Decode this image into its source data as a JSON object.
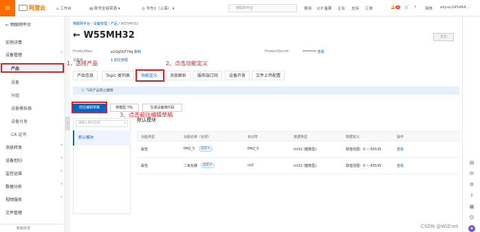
{
  "topbar": {
    "logo": "阿里云",
    "workspace": "工作台",
    "resource_group": "账号全部资源",
    "region": "华东2（上海）",
    "search_placeholder": "物联网平台",
    "links": [
      "费用",
      "ICP 备案",
      "企业",
      "支持",
      "工单"
    ],
    "badge": "49",
    "lang": "简体",
    "user": "aliyun245464..."
  },
  "sidebar": {
    "title": "物联网平台",
    "items": [
      "实例详情",
      "设备管理",
      "产品",
      "设备",
      "分组",
      "设备模拟器",
      "设备分发",
      "CA 证书",
      "消息转发",
      "设备划归",
      "监控运维",
      "数据分析",
      "视频服务",
      "文件管理"
    ],
    "footer": "新版反馈"
  },
  "breadcrumb": [
    "物联网平台",
    "设备管理",
    "产品",
    "W55MH32"
  ],
  "page_title": "W55MH32",
  "publish_btn": "发布",
  "meta": {
    "product_key_label": "ProductKey",
    "product_key_value": "a1QgDLF74g",
    "copy": "复制",
    "device_count_label": "设备数",
    "device_count_value": "1",
    "manage": "前往管理",
    "secret_label": "ProductSecret",
    "secret_value": "********",
    "view": "查看"
  },
  "tabs": [
    "产品信息",
    "Topic 类列表",
    "功能定义",
    "消息解析",
    "服务端订阅",
    "设备开发",
    "文件上传配置"
  ],
  "info_text": "飞凤产品禁止编辑",
  "buttons": {
    "edit_draft": "前往编辑草稿",
    "tsl": "物模型 TSL",
    "gen_code": "生成设备端代码"
  },
  "module": {
    "search_placeholder": "请输入模块名称",
    "current": "默认模块",
    "heading": "默认模块"
  },
  "table": {
    "headers": [
      "功能类型",
      "功能名称（全部）",
      "标识符",
      "数据类型",
      "数据定义",
      "操作"
    ],
    "rows": [
      {
        "type": "属性",
        "name": "PM2_5",
        "tag": "自定义",
        "id": "PM2_5",
        "dtype": "int32 (整数型)",
        "def": "取值范围：0 ~ 65535",
        "op": "查看"
      },
      {
        "type": "属性",
        "name": "二氧化碳",
        "tag": "自定义",
        "id": "co2",
        "dtype": "int32 (整数型)",
        "def": "取值范围：0 ~ 65535",
        "op": "查看"
      }
    ]
  },
  "annotations": {
    "step1": "1、选择产品",
    "step2": "2、点击功能定义",
    "step3": "3、点击前往编辑草稿"
  },
  "watermark": "CSDN @WIZnet",
  "colors": {
    "brand": "#ff6a00",
    "primary": "#0064c8",
    "annotation": "#e02020"
  }
}
